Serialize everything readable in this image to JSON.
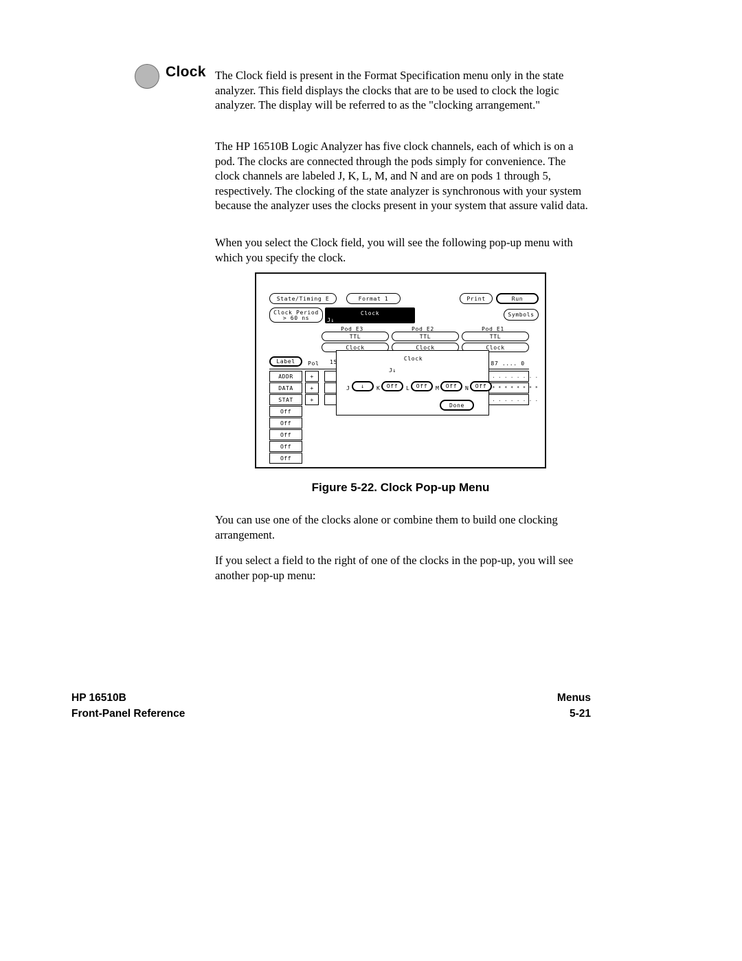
{
  "heading": {
    "bullet_icon": "gray-circle-bullet",
    "title": "Clock"
  },
  "body": {
    "para_1": "The Clock field is present in the Format Specification menu only in the state analyzer.  This field displays the clocks that are to be used to clock the logic analyzer.  The display will be referred to as the \"clocking arrangement.\"",
    "para_2": "The HP 16510B Logic Analyzer has five clock channels, each of which is on a pod. The clocks are connected through the pods simply for convenience. The clock channels are labeled J, K, L, M, and N and are on pods 1 through 5, respectively.  The clocking of the state analyzer is synchronous with your system because the analyzer uses the clocks present in your system that assure valid data.",
    "para_3": "When you select the Clock field, you will see the following pop-up menu with which you specify the clock.",
    "para_4": "You can use one of the clocks alone or combine them to build one clocking arrangement.",
    "para_5": "If you select a field to the right of one of the clocks in the pop-up, you will see another pop-up menu:"
  },
  "figure": {
    "caption": "Figure 5-22. Clock Pop-up Menu",
    "screen": {
      "menu_bar": {
        "analyzer_select": "State/Timing E",
        "menu_select": "Format 1",
        "print": "Print",
        "run": "Run",
        "symbols": "Symbols"
      },
      "clock_period": {
        "label": "Clock Period",
        "value": "> 60 ns"
      },
      "clock_field": {
        "title": "Clock",
        "arrangement": "J↓"
      },
      "pods": [
        {
          "name": "Pod E3",
          "threshold": "TTL"
        },
        {
          "name": "Pod E2",
          "threshold": "TTL"
        },
        {
          "name": "Pod E1",
          "threshold": "TTL"
        }
      ],
      "pod_row_label": "Clock",
      "pod_e1_clock": "Clock",
      "label_button": "Label",
      "pol_header": "Pol",
      "bit_ruler_left": "15",
      "bit_ruler_right": ".. 87 .... 0",
      "rows": [
        {
          "label": "ADDR",
          "pol": "+",
          "bits_left": "..",
          "bits_right": ". . . . . . . . . . . ."
        },
        {
          "label": "DATA",
          "pol": "+",
          "bits_left": "..",
          "bits_right": "* * * * * * * * * * * *"
        },
        {
          "label": "STAT",
          "pol": "+",
          "bits_left": "**",
          "bits_right": ". . . . . . . . . . . ."
        }
      ],
      "off_rows": [
        "Off",
        "Off",
        "Off",
        "Off",
        "Off"
      ],
      "popup": {
        "title": "Clock",
        "arrangement": "J↓",
        "clocks": [
          {
            "name": "J",
            "value": "↓"
          },
          {
            "name": "K",
            "value": "Off"
          },
          {
            "name": "L",
            "value": "Off"
          },
          {
            "name": "M",
            "value": "Off"
          },
          {
            "name": "N",
            "value": "Off"
          }
        ],
        "done": "Done"
      }
    }
  },
  "footer": {
    "left_line_1": "HP 16510B",
    "left_line_2": "Front-Panel Reference",
    "right_line_1": "Menus",
    "right_line_2": "5-21"
  }
}
